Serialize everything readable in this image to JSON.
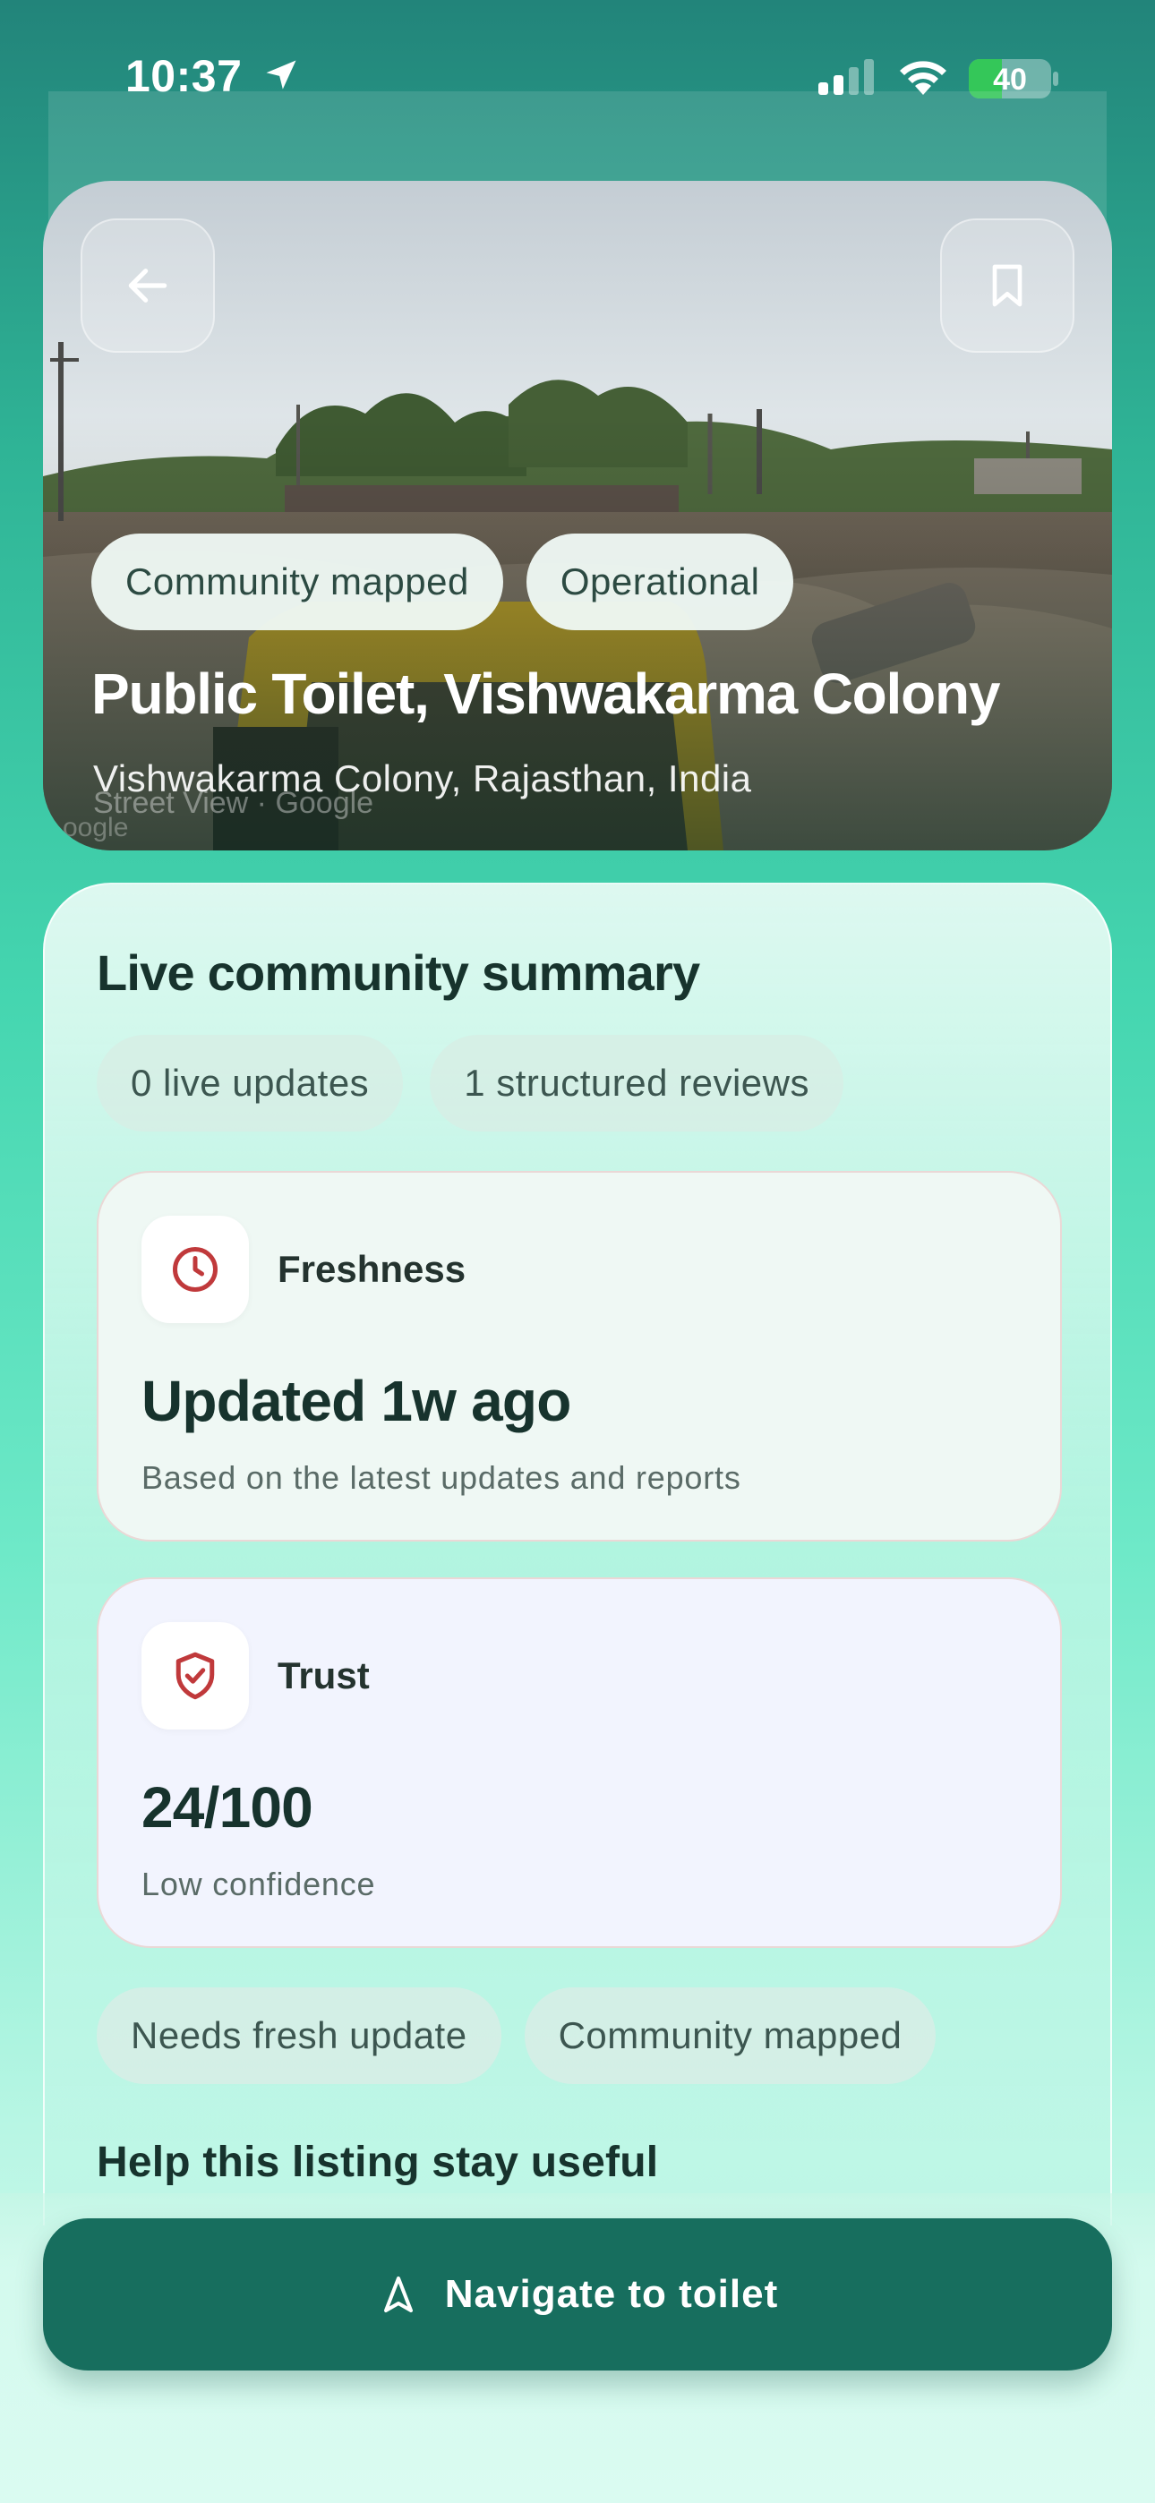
{
  "status_bar": {
    "time": "10:37",
    "battery_percent": "40",
    "battery_level": 0.4,
    "icons": [
      "location-arrow-icon",
      "cellular-signal-icon",
      "wifi-icon",
      "battery-icon"
    ]
  },
  "hero": {
    "back_icon": "arrow-left-icon",
    "bookmark_icon": "bookmark-icon",
    "chips": [
      "Community mapped",
      "Operational"
    ],
    "title": "Public Toilet, Vishwakarma Colony",
    "subtitle": "Vishwakarma Colony, Rajasthan, India",
    "credit": "Street View · Google",
    "credit_fragment": "oogle"
  },
  "summary": {
    "title": "Live community summary",
    "stats": [
      "0 live updates",
      "1 structured reviews"
    ],
    "freshness": {
      "icon": "clock-icon",
      "label": "Freshness",
      "value": "Updated 1w ago",
      "note": "Based on the latest updates and reports"
    },
    "trust": {
      "icon": "shield-check-icon",
      "label": "Trust",
      "value": "24/100",
      "note": "Low confidence"
    },
    "tags": [
      "Needs fresh update",
      "Community mapped"
    ],
    "help_title": "Help this listing stay useful"
  },
  "navigate": {
    "icon": "navigation-arrow-icon",
    "label": "Navigate to toilet"
  },
  "colors": {
    "accent": "#176e5e",
    "icon_red": "#c0393b",
    "freshness_card": "#eff8f4",
    "trust_card": "#f2f4fe"
  }
}
